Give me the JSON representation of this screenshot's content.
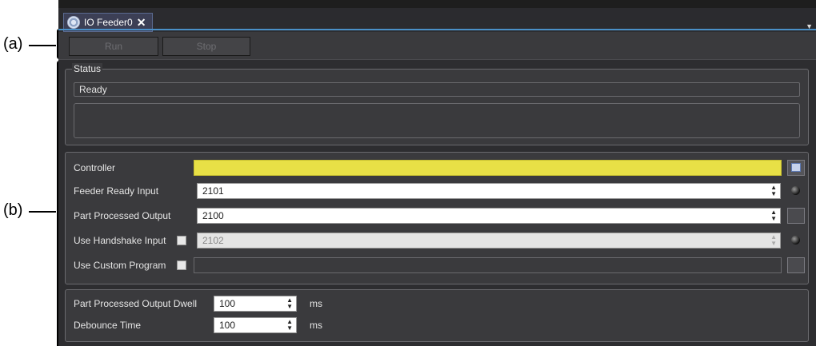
{
  "callouts": {
    "a": "(a)",
    "b": "(b)"
  },
  "tab": {
    "title": "IO Feeder0",
    "close": "✕"
  },
  "toolbar": {
    "run": "Run",
    "stop": "Stop"
  },
  "status": {
    "legend": "Status",
    "state": "Ready"
  },
  "io": {
    "controller_label": "Controller",
    "controller_value": "",
    "feeder_ready_label": "Feeder Ready Input",
    "feeder_ready_value": "2101",
    "part_processed_label": "Part Processed Output",
    "part_processed_value": "2100",
    "handshake_label": "Use Handshake Input",
    "handshake_value": "2102",
    "custom_program_label": "Use Custom Program",
    "custom_program_value": ""
  },
  "timing": {
    "dwell_label": "Part Processed Output Dwell",
    "dwell_value": "100",
    "debounce_label": "Debounce Time",
    "debounce_value": "100",
    "unit": "ms"
  },
  "colors": {
    "controller_field": "#e8e046",
    "tab_underline": "#4a90c8"
  }
}
